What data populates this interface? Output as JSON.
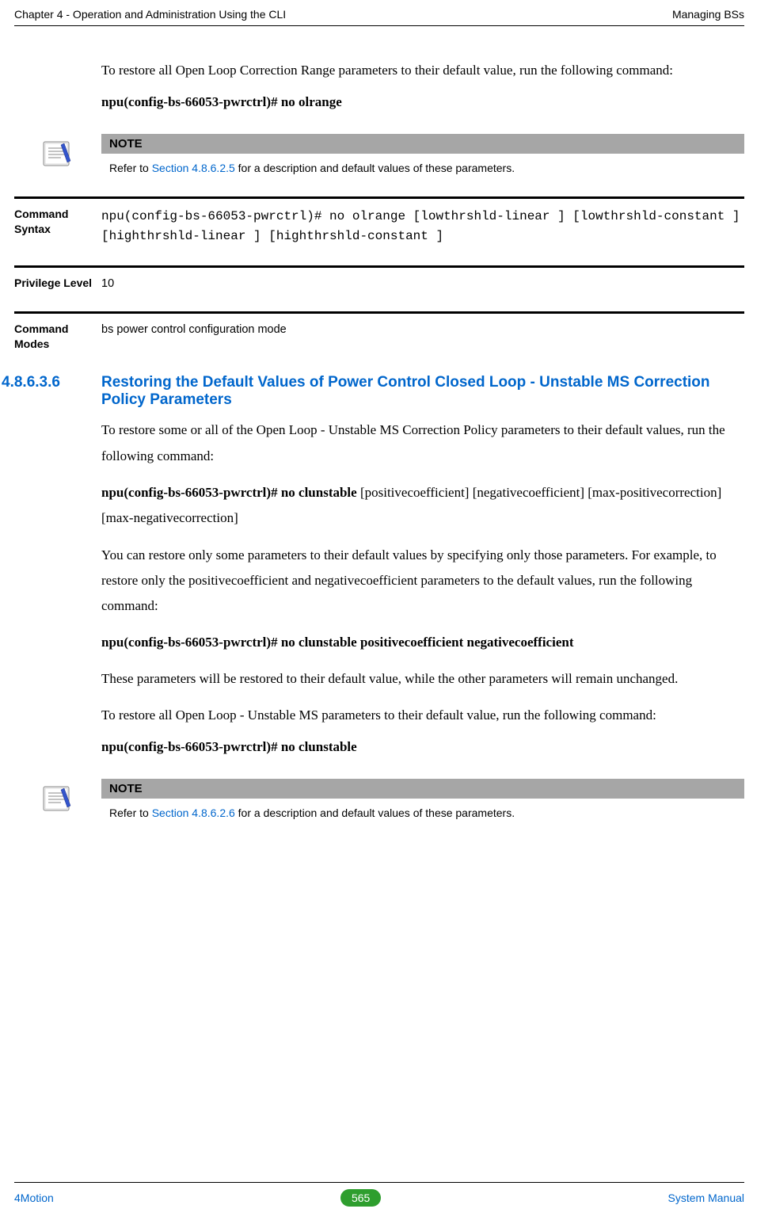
{
  "header": {
    "left": "Chapter 4 - Operation and Administration Using the CLI",
    "right": "Managing BSs"
  },
  "intro1": {
    "p1": "To restore all Open Loop Correction Range parameters to their default value, run the following command:",
    "cmd1": "npu(config-bs-66053-pwrctrl)# no olrange"
  },
  "note1": {
    "label": "NOTE",
    "prefix": "Refer to ",
    "link": "Section 4.8.6.2.5",
    "suffix": " for a description and default values of these parameters."
  },
  "defs1": {
    "syntax_label": "Command Syntax",
    "syntax_value": "npu(config-bs-66053-pwrctrl)# no olrange [lowthrshld-linear ] [lowthrshld-constant ] [highthrshld-linear ] [highthrshld-constant ]",
    "priv_label": "Privilege Level",
    "priv_value": "10",
    "modes_label": "Command Modes",
    "modes_value": "bs power control configuration mode"
  },
  "section": {
    "num": "4.8.6.3.6",
    "title": "Restoring the Default Values of Power Control Closed Loop - Unstable MS Correction Policy Parameters",
    "p1": "To restore some or all of the Open Loop - Unstable MS Correction Policy parameters to their default values, run the following command:",
    "cmd1_bold": "npu(config-bs-66053-pwrctrl)# no clunstable",
    "cmd1_rest": " [positivecoefficient] [negativecoefficient] [max-positivecorrection] [max-negativecorrection]",
    "p2": "You can restore only some parameters to their default values by specifying only those parameters. For example, to restore only the positivecoefficient and negativecoefficient parameters to the default values, run the following command:",
    "cmd2": "npu(config-bs-66053-pwrctrl)# no clunstable positivecoefficient negativecoefficient",
    "p3": "These parameters will be restored to their default value, while the other parameters will remain unchanged.",
    "p4": "To restore all Open Loop - Unstable MS parameters to their default value, run the following command:",
    "cmd3": "npu(config-bs-66053-pwrctrl)# no clunstable"
  },
  "note2": {
    "label": "NOTE",
    "prefix": "Refer to ",
    "link": "Section 4.8.6.2.6",
    "suffix": " for a description and default values of these parameters."
  },
  "footer": {
    "left": "4Motion",
    "page": "565",
    "right": " System Manual"
  }
}
